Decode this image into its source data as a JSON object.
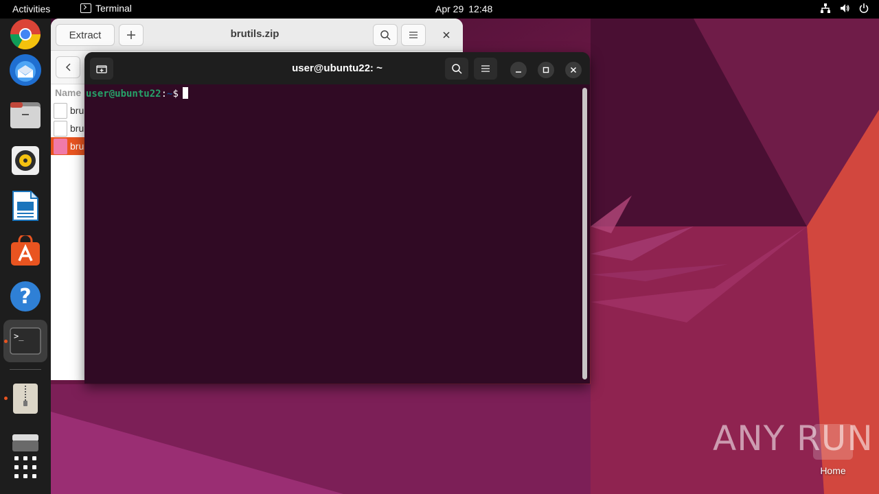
{
  "topbar": {
    "activities": "Activities",
    "app_name": "Terminal",
    "date": "Apr 29",
    "time": "12:48"
  },
  "dock": {
    "items": [
      {
        "name": "chrome"
      },
      {
        "name": "thunderbird"
      },
      {
        "name": "files"
      },
      {
        "name": "rhythmbox"
      },
      {
        "name": "libreoffice-writer"
      },
      {
        "name": "app-center"
      },
      {
        "name": "help"
      },
      {
        "name": "terminal",
        "running": true
      },
      {
        "name": "archive-manager",
        "running": true
      },
      {
        "name": "drive"
      },
      {
        "name": "show-apps"
      }
    ]
  },
  "archive": {
    "extract_label": "Extract",
    "title": "brutils.zip",
    "column_name": "Name",
    "files": [
      {
        "name": "bru",
        "selected": false
      },
      {
        "name": "bru",
        "selected": false
      },
      {
        "name": "bru",
        "selected": true
      }
    ]
  },
  "terminal": {
    "title": "user@ubuntu22: ~",
    "prompt_user": "user@ubuntu22",
    "prompt_sep": ":",
    "prompt_path": "~",
    "prompt_symbol": "$"
  },
  "desktop": {
    "watermark": "ANY RUN",
    "home_label": "Home"
  },
  "colors": {
    "accent": "#e95420",
    "terminal_bg": "#300a24"
  }
}
